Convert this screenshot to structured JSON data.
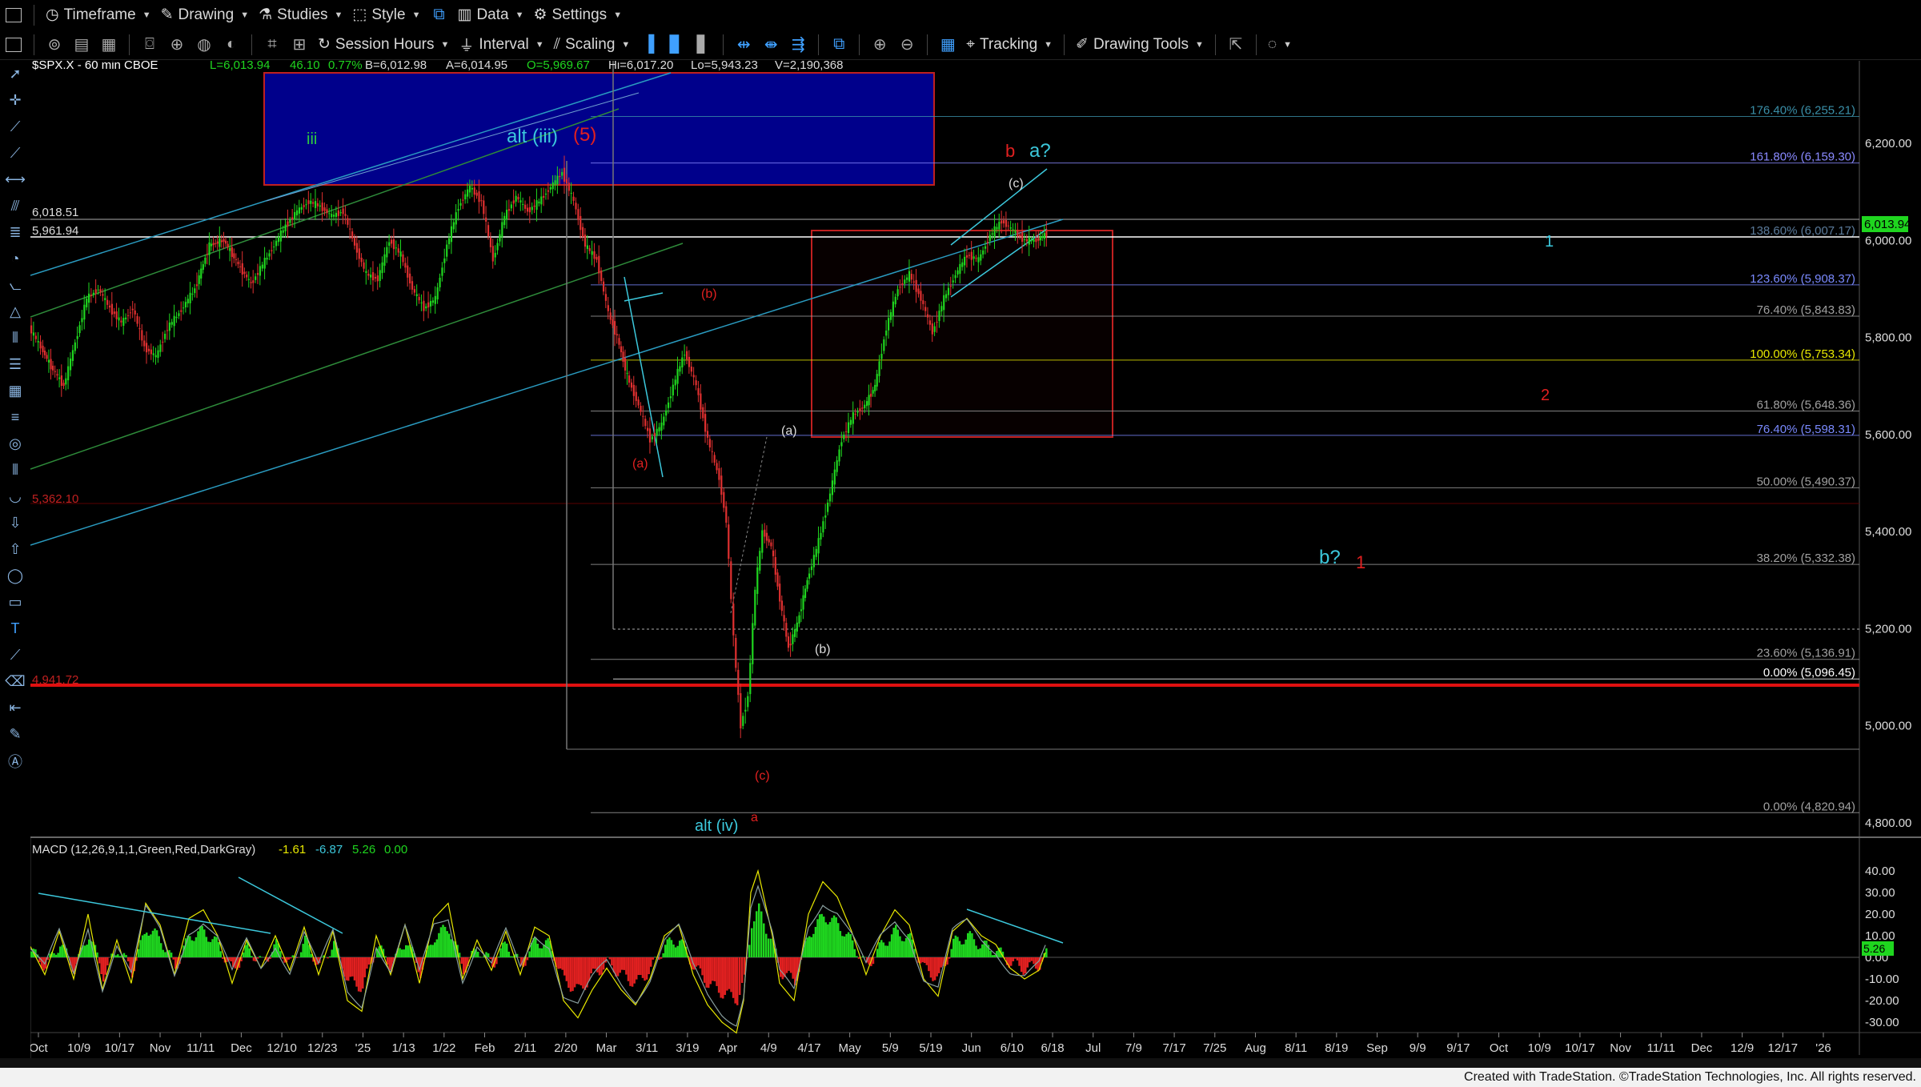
{
  "toolbar1": {
    "items": [
      "Timeframe",
      "Drawing",
      "Studies",
      "Style",
      "Data",
      "Settings"
    ]
  },
  "toolbar2": {
    "session": "Session Hours",
    "interval": "Interval",
    "scaling": "Scaling",
    "tracking": "Tracking",
    "drawing_tools": "Drawing Tools"
  },
  "header": {
    "symbol": "$SPX.X - 60 min  CBOE",
    "last": "L=6,013.94",
    "chg": "46.10",
    "pct": "0.77%",
    "bid": "B=6,012.98",
    "ask": "A=6,014.95",
    "open": "O=5,969.67",
    "high": "Hi=6,017.20",
    "low": "Lo=5,943.23",
    "vol": "V=2,190,368"
  },
  "colors": {
    "up": "#1fd61f",
    "down": "#e03030",
    "blue_box": "#00008b",
    "cyan": "#3cc8dc",
    "red": "#e02020"
  },
  "price_axis": [
    "6,200.00",
    "6,000.00",
    "5,800.00",
    "5,600.00",
    "5,400.00",
    "5,200.00",
    "5,000.00",
    "4,800.00"
  ],
  "current_price": "6,013.94",
  "left_levels": {
    "l1": "6,018.51",
    "l2": "5,961.94",
    "l3": "5,362.10",
    "l4": "4,941.72"
  },
  "fib_labels": [
    {
      "text": "176.40% (6,255.21)",
      "color": "#3a8fa8"
    },
    {
      "text": "161.80% (6,159.30)",
      "color": "#8a8aff"
    },
    {
      "text": "138.60% (6,007.17)",
      "color": "#5a7a9a"
    },
    {
      "text": "123.60% (5,908.37)",
      "color": "#7a8aff"
    },
    {
      "text": "76.40% (5,843.83)",
      "color": "#a0a0a0"
    },
    {
      "text": "100.00% (5,753.34)",
      "color": "#e8e800"
    },
    {
      "text": "61.80% (5,648.36)",
      "color": "#a0a0a0"
    },
    {
      "text": "76.40% (5,598.31)",
      "color": "#7a8aff"
    },
    {
      "text": "50.00% (5,490.37)",
      "color": "#a0a0a0"
    },
    {
      "text": "38.20% (5,332.38)",
      "color": "#a0a0a0"
    },
    {
      "text": "23.60% (5,136.91)",
      "color": "#a0a0a0"
    },
    {
      "text": "0.00% (5,096.45)",
      "color": "#ffffff"
    },
    {
      "text": "0.00% (4,820.94)",
      "color": "#a0a0a0"
    }
  ],
  "wave_labels": {
    "iii": "iii",
    "alt_iii": "alt (iii)",
    "w5": "(5)",
    "b_red": "b",
    "a_q": "a?",
    "c_top": "(c)",
    "b_paren_red": "(b)",
    "a_paren_red": "(a)",
    "a_paren": "(a)",
    "b_paren": "(b)",
    "c_red": "(c)",
    "a_red": "a",
    "alt_iv": "alt (iv)",
    "one_blue": "1",
    "two_red": "2",
    "b_q": "b?",
    "one_red": "1"
  },
  "macd": {
    "title": "MACD (12,26,9,1,1,Green,Red,DarkGray)",
    "v1": "-1.61",
    "v2": "-6.87",
    "v3": "5.26",
    "v4": "0.00",
    "axis": [
      "40.00",
      "30.00",
      "20.00",
      "10.00",
      "0.00",
      "-10.00",
      "-20.00",
      "-30.00"
    ],
    "current": "5.26"
  },
  "time_axis": [
    "Oct",
    "10/9",
    "10/17",
    "Nov",
    "11/11",
    "Dec",
    "12/10",
    "12/23",
    "'25",
    "1/13",
    "1/22",
    "Feb",
    "2/11",
    "2/20",
    "Mar",
    "3/11",
    "3/19",
    "Apr",
    "4/9",
    "4/17",
    "May",
    "5/9",
    "5/19",
    "Jun",
    "6/10",
    "6/18",
    "Jul",
    "7/9",
    "7/17",
    "7/25",
    "Aug",
    "8/11",
    "8/19",
    "Sep",
    "9/9",
    "9/17",
    "Oct",
    "10/9",
    "10/17",
    "Nov",
    "11/11",
    "Dec",
    "12/9",
    "12/17",
    "'26"
  ],
  "footer": "Created with TradeStation. ©TradeStation Technologies, Inc. All rights reserved.",
  "price_series": [
    [
      0,
      5820
    ],
    [
      16,
      5780
    ],
    [
      30,
      5740
    ],
    [
      48,
      5700
    ],
    [
      64,
      5790
    ],
    [
      80,
      5880
    ],
    [
      96,
      5900
    ],
    [
      112,
      5860
    ],
    [
      128,
      5830
    ],
    [
      144,
      5860
    ],
    [
      160,
      5780
    ],
    [
      176,
      5760
    ],
    [
      192,
      5820
    ],
    [
      208,
      5850
    ],
    [
      230,
      5900
    ],
    [
      250,
      5990
    ],
    [
      270,
      6000
    ],
    [
      290,
      5950
    ],
    [
      308,
      5910
    ],
    [
      324,
      5950
    ],
    [
      340,
      5990
    ],
    [
      356,
      6030
    ],
    [
      372,
      6060
    ],
    [
      388,
      6080
    ],
    [
      404,
      6070
    ],
    [
      420,
      6050
    ],
    [
      436,
      6060
    ],
    [
      452,
      5990
    ],
    [
      468,
      5930
    ],
    [
      484,
      5920
    ],
    [
      500,
      6000
    ],
    [
      516,
      5970
    ],
    [
      532,
      5900
    ],
    [
      548,
      5860
    ],
    [
      564,
      5880
    ],
    [
      580,
      5990
    ],
    [
      596,
      6070
    ],
    [
      612,
      6110
    ],
    [
      628,
      6080
    ],
    [
      644,
      5960
    ],
    [
      660,
      6050
    ],
    [
      676,
      6090
    ],
    [
      692,
      6060
    ],
    [
      708,
      6080
    ],
    [
      724,
      6110
    ],
    [
      740,
      6140
    ],
    [
      756,
      6080
    ],
    [
      772,
      5990
    ],
    [
      788,
      5960
    ],
    [
      804,
      5850
    ],
    [
      816,
      5800
    ],
    [
      830,
      5720
    ],
    [
      846,
      5660
    ],
    [
      862,
      5590
    ],
    [
      878,
      5620
    ],
    [
      894,
      5700
    ],
    [
      910,
      5770
    ],
    [
      926,
      5700
    ],
    [
      942,
      5590
    ],
    [
      958,
      5510
    ],
    [
      968,
      5420
    ],
    [
      978,
      5180
    ],
    [
      988,
      5000
    ],
    [
      998,
      5060
    ],
    [
      1008,
      5280
    ],
    [
      1018,
      5400
    ],
    [
      1030,
      5370
    ],
    [
      1042,
      5260
    ],
    [
      1054,
      5160
    ],
    [
      1066,
      5210
    ],
    [
      1080,
      5300
    ],
    [
      1096,
      5380
    ],
    [
      1112,
      5480
    ],
    [
      1128,
      5590
    ],
    [
      1144,
      5640
    ],
    [
      1160,
      5660
    ],
    [
      1174,
      5700
    ],
    [
      1190,
      5820
    ],
    [
      1206,
      5900
    ],
    [
      1222,
      5930
    ],
    [
      1238,
      5880
    ],
    [
      1254,
      5810
    ],
    [
      1270,
      5880
    ],
    [
      1286,
      5930
    ],
    [
      1302,
      5970
    ],
    [
      1318,
      5960
    ],
    [
      1334,
      6010
    ],
    [
      1350,
      6040
    ],
    [
      1366,
      6020
    ],
    [
      1382,
      6000
    ],
    [
      1398,
      6000
    ],
    [
      1412,
      6014
    ]
  ],
  "macd_series": [
    [
      0,
      5
    ],
    [
      20,
      -8
    ],
    [
      40,
      12
    ],
    [
      60,
      -10
    ],
    [
      80,
      20
    ],
    [
      100,
      -15
    ],
    [
      120,
      8
    ],
    [
      140,
      -12
    ],
    [
      160,
      25
    ],
    [
      180,
      15
    ],
    [
      200,
      -8
    ],
    [
      220,
      18
    ],
    [
      240,
      22
    ],
    [
      260,
      10
    ],
    [
      280,
      -12
    ],
    [
      300,
      8
    ],
    [
      320,
      -5
    ],
    [
      340,
      10
    ],
    [
      360,
      -6
    ],
    [
      380,
      14
    ],
    [
      400,
      -8
    ],
    [
      420,
      12
    ],
    [
      440,
      -20
    ],
    [
      460,
      -25
    ],
    [
      480,
      10
    ],
    [
      500,
      -8
    ],
    [
      520,
      15
    ],
    [
      540,
      -12
    ],
    [
      560,
      18
    ],
    [
      580,
      25
    ],
    [
      600,
      -10
    ],
    [
      620,
      8
    ],
    [
      640,
      -6
    ],
    [
      660,
      12
    ],
    [
      680,
      -8
    ],
    [
      700,
      14
    ],
    [
      720,
      10
    ],
    [
      740,
      -20
    ],
    [
      760,
      -28
    ],
    [
      780,
      -15
    ],
    [
      800,
      -5
    ],
    [
      820,
      -15
    ],
    [
      840,
      -22
    ],
    [
      860,
      -10
    ],
    [
      880,
      10
    ],
    [
      900,
      15
    ],
    [
      920,
      -8
    ],
    [
      940,
      -22
    ],
    [
      960,
      -30
    ],
    [
      980,
      -35
    ],
    [
      990,
      -20
    ],
    [
      1000,
      30
    ],
    [
      1010,
      40
    ],
    [
      1020,
      25
    ],
    [
      1030,
      10
    ],
    [
      1040,
      -12
    ],
    [
      1060,
      -20
    ],
    [
      1080,
      20
    ],
    [
      1100,
      35
    ],
    [
      1120,
      28
    ],
    [
      1140,
      12
    ],
    [
      1160,
      -8
    ],
    [
      1180,
      10
    ],
    [
      1200,
      22
    ],
    [
      1220,
      15
    ],
    [
      1240,
      -10
    ],
    [
      1260,
      -18
    ],
    [
      1280,
      12
    ],
    [
      1300,
      18
    ],
    [
      1320,
      10
    ],
    [
      1340,
      6
    ],
    [
      1360,
      -5
    ],
    [
      1380,
      -10
    ],
    [
      1400,
      -6
    ],
    [
      1412,
      5
    ]
  ]
}
